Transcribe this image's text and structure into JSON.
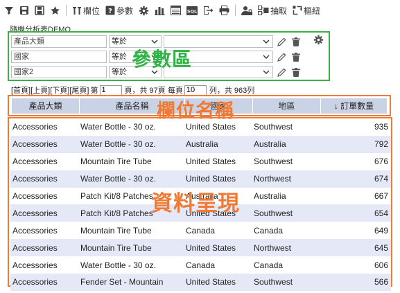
{
  "toolbar": {
    "items": [
      {
        "icon": "filter-icon"
      },
      {
        "icon": "save-icon"
      },
      {
        "icon": "save-as-icon"
      },
      {
        "icon": "star-icon"
      },
      {
        "icon": "columns-icon",
        "label": "欄位"
      },
      {
        "icon": "help-params-icon",
        "label": "參數"
      },
      {
        "icon": "settings-icon"
      },
      {
        "icon": "bar-chart-icon"
      },
      {
        "icon": "layout-icon"
      },
      {
        "icon": "sql-icon",
        "text": "SQL"
      },
      {
        "icon": "export-icon"
      },
      {
        "icon": "print-icon"
      },
      {
        "icon": "user-lock-icon"
      },
      {
        "icon": "extract-icon",
        "label": "抽取"
      },
      {
        "icon": "pivot-icon",
        "label": "樞紐"
      }
    ]
  },
  "report_title": "隨機分析表DEMO",
  "params": [
    {
      "name": "產品大類",
      "op": "等於",
      "value": ""
    },
    {
      "name": "國家",
      "op": "等於",
      "value": ""
    },
    {
      "name": "國家2",
      "op": "等於",
      "value": ""
    }
  ],
  "callouts": {
    "params": "參數區",
    "header": "欄位名稱",
    "data": "資料呈現"
  },
  "pager": {
    "first": "[首頁]",
    "prev": "[上頁]",
    "next": "[下頁]",
    "last": "[尾頁]",
    "page_prefix": "第",
    "page_value": "1",
    "page_suffix": "頁，共 97頁 每頁",
    "per_page_value": "10",
    "per_page_suffix": "列，共 963列"
  },
  "columns": [
    "產品大類",
    "產品名稱",
    "國家",
    "地區",
    "訂單數量"
  ],
  "sort_indicator": "↓",
  "rows": [
    [
      "Accessories",
      "Water Bottle - 30 oz.",
      "United States",
      "Southwest",
      "935"
    ],
    [
      "Accessories",
      "Water Bottle - 30 oz.",
      "Australia",
      "Australia",
      "792"
    ],
    [
      "Accessories",
      "Mountain Tire Tube",
      "United States",
      "Southwest",
      "676"
    ],
    [
      "Accessories",
      "Water Bottle - 30 oz.",
      "United States",
      "Northwest",
      "674"
    ],
    [
      "Accessories",
      "Patch Kit/8 Patches",
      "Australia",
      "Australia",
      "667"
    ],
    [
      "Accessories",
      "Patch Kit/8 Patches",
      "United States",
      "Southwest",
      "654"
    ],
    [
      "Accessories",
      "Mountain Tire Tube",
      "Canada",
      "Canada",
      "649"
    ],
    [
      "Accessories",
      "Mountain Tire Tube",
      "United States",
      "Northwest",
      "645"
    ],
    [
      "Accessories",
      "Water Bottle - 30 oz.",
      "Canada",
      "Canada",
      "606"
    ],
    [
      "Accessories",
      "Fender Set - Mountain",
      "United States",
      "Southwest",
      "566"
    ]
  ]
}
